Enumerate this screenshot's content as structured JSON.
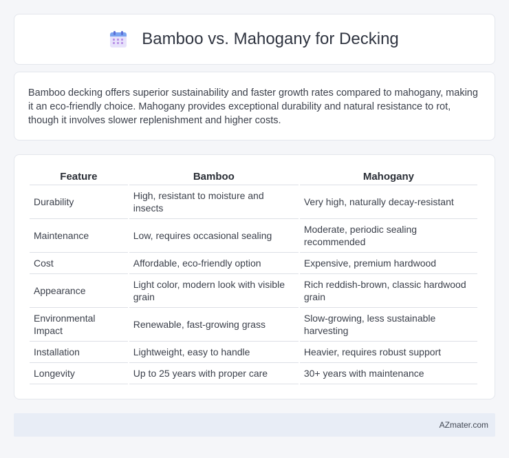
{
  "header": {
    "title": "Bamboo vs. Mahogany for Decking",
    "icon": "calendar-icon"
  },
  "intro": {
    "text": "Bamboo decking offers superior sustainability and faster growth rates compared to mahogany, making it an eco-friendly choice. Mahogany provides exceptional durability and natural resistance to rot, though it involves slower replenishment and higher costs."
  },
  "table": {
    "headers": [
      "Feature",
      "Bamboo",
      "Mahogany"
    ],
    "rows": [
      [
        "Durability",
        "High, resistant to moisture and insects",
        "Very high, naturally decay-resistant"
      ],
      [
        "Maintenance",
        "Low, requires occasional sealing",
        "Moderate, periodic sealing recommended"
      ],
      [
        "Cost",
        "Affordable, eco-friendly option",
        "Expensive, premium hardwood"
      ],
      [
        "Appearance",
        "Light color, modern look with visible grain",
        "Rich reddish-brown, classic hardwood grain"
      ],
      [
        "Environmental Impact",
        "Renewable, fast-growing grass",
        "Slow-growing, less sustainable harvesting"
      ],
      [
        "Installation",
        "Lightweight, easy to handle",
        "Heavier, requires robust support"
      ],
      [
        "Longevity",
        "Up to 25 years with proper care",
        "30+ years with maintenance"
      ]
    ]
  },
  "footer": {
    "brand": "AZmater.com"
  }
}
